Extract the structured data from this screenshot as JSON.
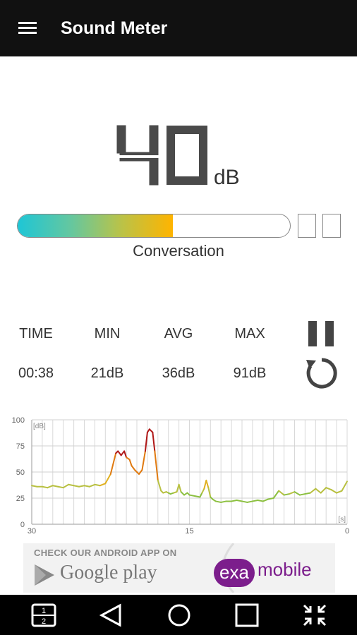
{
  "app": {
    "title": "Sound Meter"
  },
  "meter": {
    "reading": "40",
    "unit": "dB",
    "level_label": "Conversation",
    "fill_fraction": 0.57
  },
  "stats": {
    "headers": [
      "TIME",
      "MIN",
      "AVG",
      "MAX"
    ],
    "values": [
      "00:38",
      "21dB",
      "36dB",
      "91dB"
    ]
  },
  "chart_data": {
    "type": "line",
    "y_unit_label": "[dB]",
    "x_unit_label": "[s]",
    "y_ticks": [
      "100",
      "75",
      "50",
      "25",
      "0"
    ],
    "x_ticks": [
      "30",
      "15",
      "0"
    ],
    "ylim": [
      0,
      100
    ],
    "xlim": [
      30,
      0
    ],
    "series": [
      {
        "x": [
          30,
          29.5,
          29,
          28.5,
          28,
          27.5,
          27,
          26.5,
          26,
          25.5,
          25,
          24.5,
          24,
          23.5,
          23,
          22.5,
          22,
          21.8,
          21.5,
          21.2,
          21,
          20.7,
          20.5,
          20.2,
          20,
          19.8,
          19.5,
          19.2,
          19,
          18.8,
          18.5,
          18.3,
          18,
          17.7,
          17.5,
          17.2,
          17,
          16.8,
          16.5,
          16.2,
          16,
          15.8,
          15.5,
          15.2,
          15,
          14.5,
          14,
          13.8,
          13.6,
          13.4,
          13.2,
          13,
          12.8,
          12.5,
          12,
          11.5,
          11,
          10.5,
          10,
          9.5,
          9,
          8.5,
          8,
          7.5,
          7,
          6.5,
          6,
          5.5,
          5,
          4.5,
          4,
          3.5,
          3,
          2.5,
          2,
          1.5,
          1,
          0.5,
          0
        ],
        "y": [
          37,
          36,
          36,
          35,
          37,
          36,
          35,
          38,
          37,
          36,
          37,
          36,
          38,
          37,
          39,
          48,
          68,
          70,
          66,
          70,
          64,
          62,
          56,
          52,
          50,
          48,
          52,
          70,
          88,
          91,
          88,
          70,
          42,
          32,
          30,
          31,
          30,
          29,
          30,
          31,
          38,
          31,
          28,
          30,
          28,
          27,
          26,
          30,
          34,
          42,
          35,
          26,
          24,
          22,
          21,
          22,
          22,
          23,
          22,
          21,
          22,
          23,
          22,
          24,
          25,
          32,
          28,
          29,
          31,
          28,
          29,
          30,
          34,
          30,
          35,
          33,
          30,
          32,
          41
        ]
      }
    ]
  },
  "ad": {
    "line1": "CHECK OUR ANDROID APP ON",
    "store": "Google play",
    "brand_a": "exa",
    "brand_b": "mobile"
  },
  "icons": {
    "menu": "menu-icon",
    "pause": "pause-icon",
    "reset": "reset-icon",
    "nav_switch": "sim-switch-icon",
    "nav_back": "back-icon",
    "nav_home": "home-icon",
    "nav_recents": "recents-icon",
    "nav_shrink": "collapse-icon"
  }
}
